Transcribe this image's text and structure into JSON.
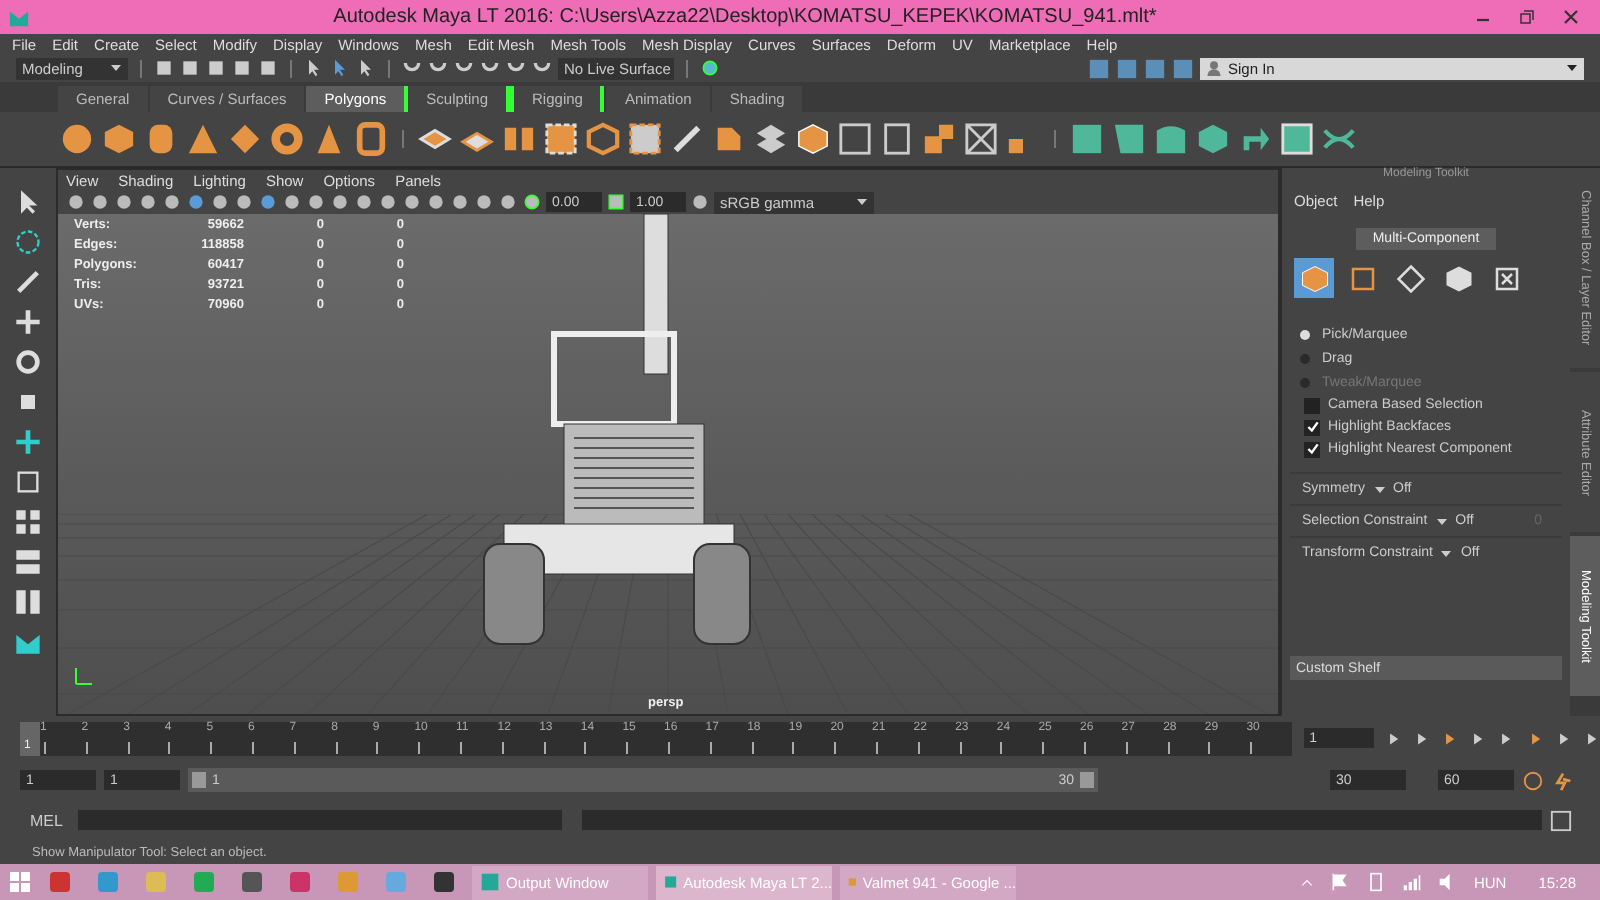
{
  "window": {
    "title": "Autodesk Maya LT 2016: C:\\Users\\Azza22\\Desktop\\KOMATSU_KEPEK\\KOMATSU_941.mlt*"
  },
  "menu": [
    "File",
    "Edit",
    "Create",
    "Select",
    "Modify",
    "Display",
    "Windows",
    "Mesh",
    "Edit Mesh",
    "Mesh Tools",
    "Mesh Display",
    "Curves",
    "Surfaces",
    "Deform",
    "UV",
    "Marketplace",
    "Help"
  ],
  "status_line": {
    "mode": "Modeling",
    "live_surface": "No Live Surface",
    "sign_in": "Sign In"
  },
  "shelf_tabs": [
    {
      "label": "General",
      "selected": false
    },
    {
      "label": "Curves / Surfaces",
      "selected": false
    },
    {
      "label": "Polygons",
      "selected": true
    },
    {
      "label": "Sculpting",
      "selected": false
    },
    {
      "label": "Rigging",
      "selected": false
    },
    {
      "label": "Animation",
      "selected": false
    },
    {
      "label": "Shading",
      "selected": false
    }
  ],
  "viewport": {
    "menu": [
      "View",
      "Shading",
      "Lighting",
      "Show",
      "Options",
      "Panels"
    ],
    "exposure": "0.00",
    "gamma": "1.00",
    "color_space": "sRGB gamma",
    "camera": "persp",
    "stats": [
      {
        "label": "Verts:",
        "values": [
          "59662",
          "0",
          "0"
        ]
      },
      {
        "label": "Edges:",
        "values": [
          "118858",
          "0",
          "0"
        ]
      },
      {
        "label": "Polygons:",
        "values": [
          "60417",
          "0",
          "0"
        ]
      },
      {
        "label": "Tris:",
        "values": [
          "93721",
          "0",
          "0"
        ]
      },
      {
        "label": "UVs:",
        "values": [
          "70960",
          "0",
          "0"
        ]
      }
    ]
  },
  "modeling_toolkit": {
    "title": "Modeling Toolkit",
    "menu": [
      "Object",
      "Help"
    ],
    "mode": "Multi-Component",
    "selection_modes": [
      {
        "kind": "object",
        "selected": true
      },
      {
        "kind": "vertex",
        "selected": false
      },
      {
        "kind": "edge",
        "selected": false
      },
      {
        "kind": "face",
        "selected": false
      },
      {
        "kind": "uv",
        "selected": false
      }
    ],
    "pick_modes": [
      {
        "label": "Pick/Marquee",
        "selected": true,
        "disabled": false
      },
      {
        "label": "Drag",
        "selected": false,
        "disabled": false
      },
      {
        "label": "Tweak/Marquee",
        "selected": false,
        "disabled": true
      }
    ],
    "options": [
      {
        "label": "Camera Based Selection",
        "checked": false
      },
      {
        "label": "Highlight Backfaces",
        "checked": true
      },
      {
        "label": "Highlight Nearest Component",
        "checked": true
      }
    ],
    "constraints": [
      {
        "label": "Symmetry",
        "value": "Off"
      },
      {
        "label": "Selection Constraint",
        "value": "Off",
        "extra": "0"
      },
      {
        "label": "Transform Constraint",
        "value": "Off"
      }
    ],
    "custom_shelf": "Custom Shelf"
  },
  "side_tabs": [
    {
      "label": "Channel Box / Layer Editor",
      "selected": false
    },
    {
      "label": "Attribute Editor",
      "selected": false
    },
    {
      "label": "Modeling Toolkit",
      "selected": true
    }
  ],
  "time_slider": {
    "ticks": [
      "1",
      "2",
      "3",
      "4",
      "5",
      "6",
      "7",
      "8",
      "9",
      "10",
      "11",
      "12",
      "13",
      "14",
      "15",
      "16",
      "17",
      "18",
      "19",
      "20",
      "21",
      "22",
      "23",
      "24",
      "25",
      "26",
      "27",
      "28",
      "29",
      "30"
    ],
    "current_marker": "1",
    "current_field": "1"
  },
  "range_slider": {
    "start": "1",
    "playback_start": "1",
    "range_start": "1",
    "range_end": "30",
    "level": 1,
    "playback_end": "30",
    "end": "60"
  },
  "command_line": {
    "label": "MEL"
  },
  "help_line": "Show Manipulator Tool: Select an object.",
  "taskbar": {
    "apps": [
      {
        "label": "Output Window",
        "selected": false
      },
      {
        "label": "Autodesk Maya LT 2...",
        "selected": true
      },
      {
        "label": "Valmet 941 - Google ...",
        "selected": false
      }
    ],
    "language": "HUN",
    "time": "15:28"
  }
}
